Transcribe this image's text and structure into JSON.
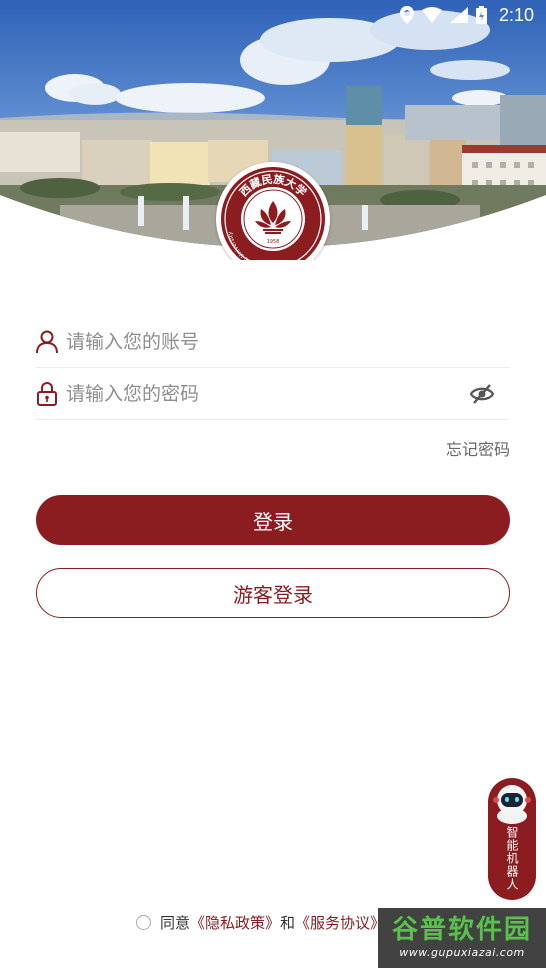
{
  "status_bar": {
    "time": "2:10",
    "icons": [
      "location-icon",
      "wifi-icon",
      "signal-icon",
      "battery-icon"
    ]
  },
  "logo": {
    "name": "西藏民族大学",
    "english": "Xizang Minzu University",
    "year": "1958"
  },
  "login": {
    "account_placeholder": "请输入您的账号",
    "password_placeholder": "请输入您的密码",
    "forgot_label": "忘记密码",
    "login_label": "登录",
    "guest_label": "游客登录"
  },
  "robot": {
    "label": "智能机器人"
  },
  "agreement": {
    "prefix": "同意",
    "privacy": "《隐私政策》",
    "and": "和",
    "service": "《服务协议》"
  },
  "watermark": {
    "title": "谷普软件园",
    "url": "www.gupuxiazai.com"
  },
  "colors": {
    "brand": "#8b1d21",
    "sky": "#3b6fc4",
    "text_gray": "#8e8e8e"
  }
}
